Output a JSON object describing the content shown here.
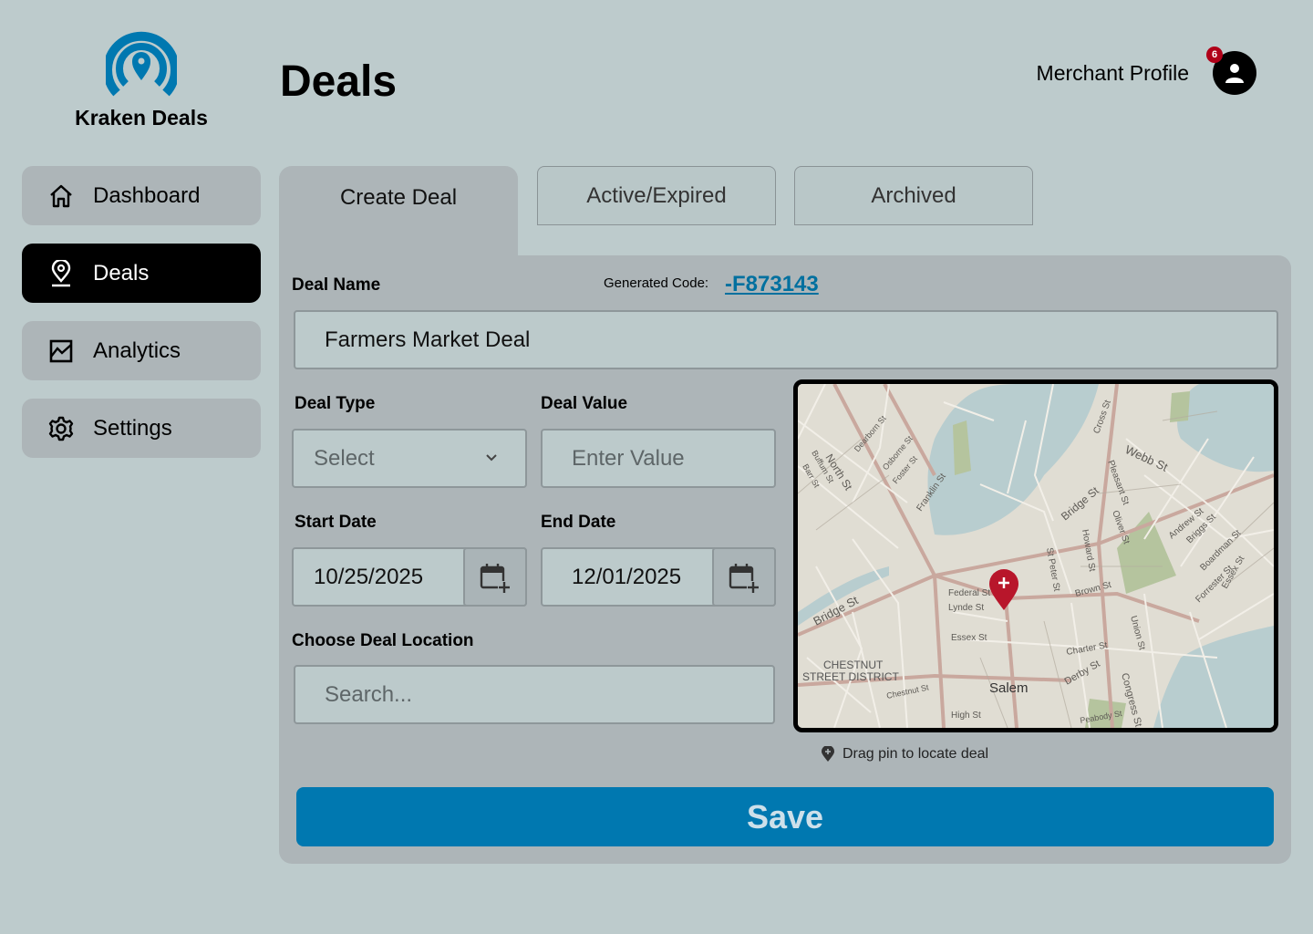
{
  "brand": {
    "name": "Kraken Deals",
    "accent": "#0078b0"
  },
  "page": {
    "title": "Deals"
  },
  "header": {
    "profile_label": "Merchant Profile",
    "notification_count": "6"
  },
  "sidebar": {
    "items": [
      {
        "label": "Dashboard",
        "icon": "home-icon"
      },
      {
        "label": "Deals",
        "icon": "location-pin-icon"
      },
      {
        "label": "Analytics",
        "icon": "chart-icon"
      },
      {
        "label": "Settings",
        "icon": "gear-icon"
      }
    ]
  },
  "tabs": [
    {
      "label": "Create Deal"
    },
    {
      "label": "Active/Expired"
    },
    {
      "label": "Archived"
    }
  ],
  "form": {
    "deal_name_label": "Deal Name",
    "generated_code_label": "Generated Code:",
    "generated_code": "-F873143",
    "deal_name_value": "Farmers Market Deal",
    "deal_type_label": "Deal Type",
    "deal_type_value": "Select",
    "deal_value_label": "Deal Value",
    "deal_value_placeholder": "Enter Value",
    "start_date_label": "Start Date",
    "start_date_value": "10/25/2025",
    "end_date_label": "End Date",
    "end_date_value": "12/01/2025",
    "location_label": "Choose Deal Location",
    "location_placeholder": "Search...",
    "map_hint": "Drag pin to locate deal",
    "save_label": "Save"
  },
  "map": {
    "labels": [
      "North St",
      "Bridge St",
      "Webb St",
      "Federal St",
      "Lynde St",
      "Essex St",
      "Salem",
      "CHESTNUT",
      "STREET DISTRICT",
      "Chestnut St",
      "High St",
      "Derby St",
      "Congress St",
      "Charter St",
      "Brown St",
      "Bridge St",
      "Andrew St",
      "Briggs St",
      "Pleasant St",
      "Oliver St",
      "Howard St",
      "St Peter St",
      "Franklin St",
      "Osborne St",
      "Foster St",
      "Dearborn St",
      "Cross St",
      "Union St",
      "Peabody St",
      "Boardman St",
      "Forrester St",
      "Essex St",
      "Buffum St",
      "Barr St"
    ]
  }
}
